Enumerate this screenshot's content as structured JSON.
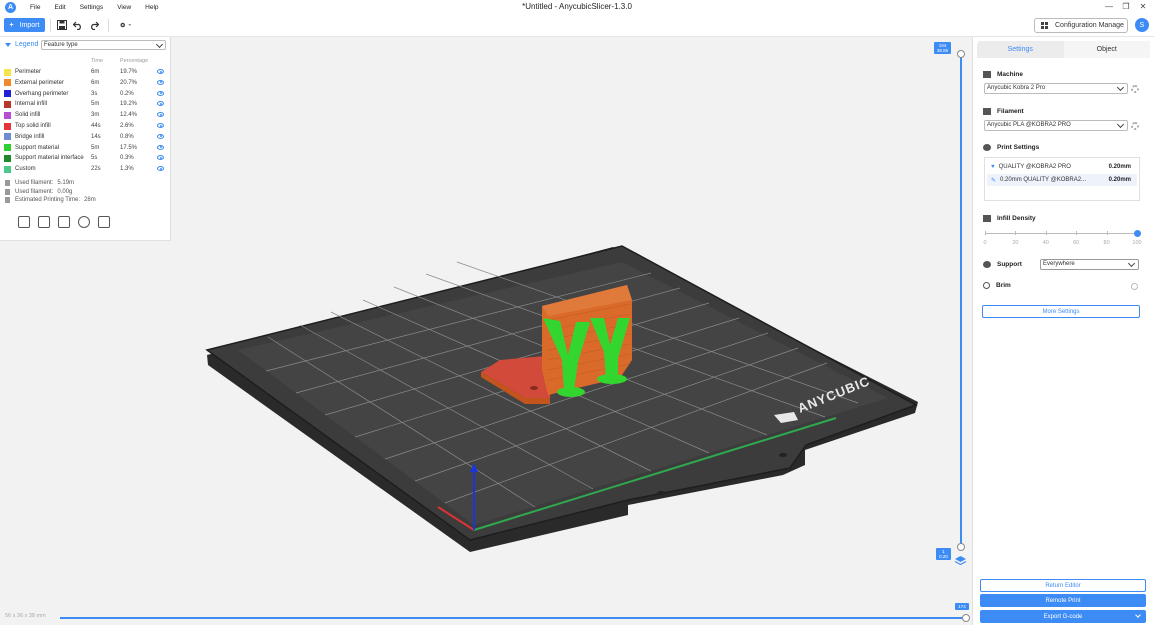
{
  "window": {
    "title": "*Untitled - AnycubicSlicer-1.3.0",
    "logo_letter": "A",
    "menu": [
      "File",
      "Edit",
      "Settings",
      "View",
      "Help"
    ],
    "min_glyph": "—",
    "max_glyph": "❐",
    "close_glyph": "✕"
  },
  "toolbar": {
    "import_label": "Import",
    "config_label": "Configuration Manage",
    "avatar_letter": "S"
  },
  "legend": {
    "title": "Legend",
    "feature_select": "Feature type",
    "col_time": "Time",
    "col_percentage": "Percentage",
    "items": [
      {
        "label": "Perimeter",
        "time": "6m",
        "percent": "19.7%",
        "color": "#f7e34b"
      },
      {
        "label": "External perimeter",
        "time": "6m",
        "percent": "20.7%",
        "color": "#f08a2c"
      },
      {
        "label": "Overhang perimeter",
        "time": "3s",
        "percent": "0.2%",
        "color": "#1f1fd6"
      },
      {
        "label": "Internal infill",
        "time": "5m",
        "percent": "19.2%",
        "color": "#b8372b"
      },
      {
        "label": "Solid infill",
        "time": "3m",
        "percent": "12.4%",
        "color": "#b44fd6"
      },
      {
        "label": "Top solid infill",
        "time": "44s",
        "percent": "2.6%",
        "color": "#e6353a"
      },
      {
        "label": "Bridge infill",
        "time": "14s",
        "percent": "0.8%",
        "color": "#6e8ccf"
      },
      {
        "label": "Support material",
        "time": "5m",
        "percent": "17.5%",
        "color": "#2ed12e"
      },
      {
        "label": "Support material interface",
        "time": "5s",
        "percent": "0.3%",
        "color": "#1e8a2c"
      },
      {
        "label": "Custom",
        "time": "22s",
        "percent": "1.3%",
        "color": "#4cc98a"
      }
    ],
    "used_filament_len_label": "Used filament:",
    "used_filament_len": "5.19m",
    "used_filament_wt_label": "Used filament:",
    "used_filament_wt": "0.00g",
    "est_time_label": "Estimated Printing Time:",
    "est_time": "28m"
  },
  "right_panel": {
    "tab_settings": "Settings",
    "tab_object": "Object",
    "machine_label": "Machine",
    "machine_value": "Anycubic Kobra 2 Pro",
    "filament_label": "Filament",
    "filament_value": "Anycubic PLA @KOBRA2 PRO",
    "print_settings_label": "Print Settings",
    "print_rows": [
      {
        "name": "QUALITY @KOBRA2 PRO",
        "value": "0.20mm"
      },
      {
        "name": "0.20mm QUALITY @KOBRA2...",
        "value": "0.20mm"
      }
    ],
    "infill_label": "Infill Density",
    "infill_ticks": [
      "0",
      "20",
      "40",
      "60",
      "80",
      "100"
    ],
    "infill_value_percent": 100,
    "support_label": "Support",
    "support_value": "Everywhere",
    "brim_label": "Brim",
    "more_settings": "More Settings",
    "return_editor": "Return Editor",
    "remote_print": "Remote Print",
    "export_gcode": "Export G-code"
  },
  "sliders": {
    "top_layer": "194",
    "top_height": "38.85",
    "bottom_layer": "1",
    "bottom_height": "0.20",
    "move_value": "174",
    "model_size": "56 x 36 x 38 mm"
  },
  "bed": {
    "brand": "ANYCUBIC"
  },
  "colors": {
    "accent": "#3d8cf5",
    "bed": "#3a3a3a",
    "model": "#d96a2a",
    "support": "#33d62e"
  }
}
